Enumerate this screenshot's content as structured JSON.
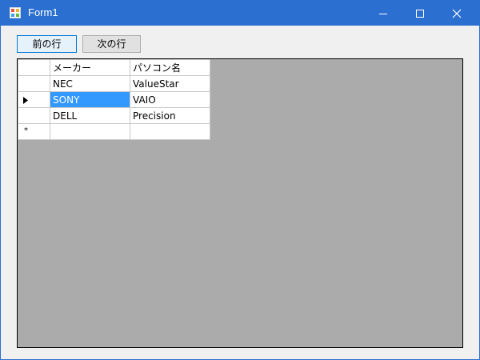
{
  "window": {
    "title": "Form1"
  },
  "buttons": {
    "prev_label": "前の行",
    "next_label": "次の行"
  },
  "grid": {
    "columns": [
      "メーカー",
      "パソコン名"
    ],
    "rows": [
      {
        "maker": "NEC",
        "pc": "ValueStar"
      },
      {
        "maker": "SONY",
        "pc": "VAIO"
      },
      {
        "maker": "DELL",
        "pc": "Precision"
      }
    ],
    "new_row_marker": "*"
  },
  "colors": {
    "titlebar": "#2b6fd0",
    "selection": "#3399ff",
    "grid_background": "#ababab"
  },
  "icons": [
    "app-icon",
    "minimize-icon",
    "maximize-icon",
    "close-icon",
    "current-row-arrow-icon"
  ]
}
